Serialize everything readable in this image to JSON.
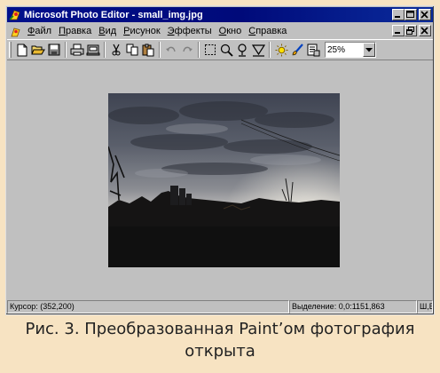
{
  "window": {
    "title": "Microsoft Photo Editor - small_img.jpg",
    "caption_buttons": [
      "minimize-icon",
      "maximize-icon",
      "close-icon"
    ],
    "doc_buttons": [
      "minimize-icon",
      "restore-icon",
      "close-icon"
    ]
  },
  "menu": {
    "items": [
      {
        "ul": "Ф",
        "rest": "айл"
      },
      {
        "ul": "П",
        "rest": "равка"
      },
      {
        "ul": "В",
        "rest": "ид"
      },
      {
        "ul": "Р",
        "rest": "исунок"
      },
      {
        "ul": "Э",
        "rest": "ффекты"
      },
      {
        "ul": "О",
        "rest": "кно"
      },
      {
        "ul": "С",
        "rest": "правка"
      }
    ]
  },
  "toolbar": {
    "icons": [
      "new-icon",
      "open-icon",
      "save-icon",
      "print-icon",
      "scan-icon",
      "cut-icon",
      "copy-icon",
      "paste-icon",
      "undo-icon",
      "redo-icon",
      "select-icon",
      "zoom-icon",
      "pointer-icon",
      "crop-icon",
      "brightness-icon",
      "paint-icon",
      "properties-icon"
    ],
    "zoom_value": "25%"
  },
  "status": {
    "cursor": "Курсор: (352,200)",
    "selection": "Выделение: 0,0:1151,863",
    "extra": "Ш,В"
  },
  "caption": {
    "line1": "Рис. 3. Преобразованная Paint’ом фотография",
    "line2": "открыта"
  },
  "colors": {
    "title_bar": "#00108c",
    "window_face": "#c0c0c0",
    "page_bg": "#f7e3c2"
  }
}
